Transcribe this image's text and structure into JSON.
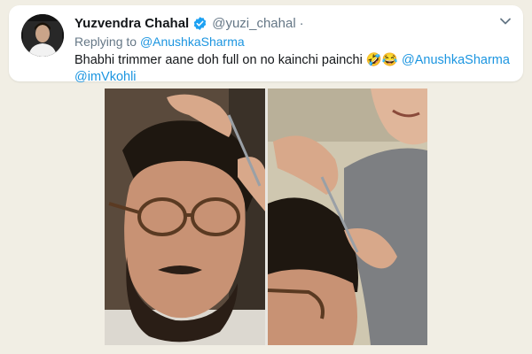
{
  "tweet": {
    "author_name": "Yuzvendra Chahal",
    "author_handle": "@yuzi_chahal",
    "separator": "·",
    "replying_prefix": "Replying to",
    "replying_to": "@AnushkaSharma",
    "text": "Bhabhi trimmer aane doh full on no kainchi painchi",
    "emojis": "🤣😂",
    "mentions": [
      "@AnushkaSharma",
      "@imVkohli"
    ],
    "verified_color": "#1da1f2",
    "link_color": "#1b95e0"
  },
  "icons": {
    "avatar": "avatar",
    "verified": "verified-badge-icon",
    "menu": "chevron-down-icon"
  }
}
